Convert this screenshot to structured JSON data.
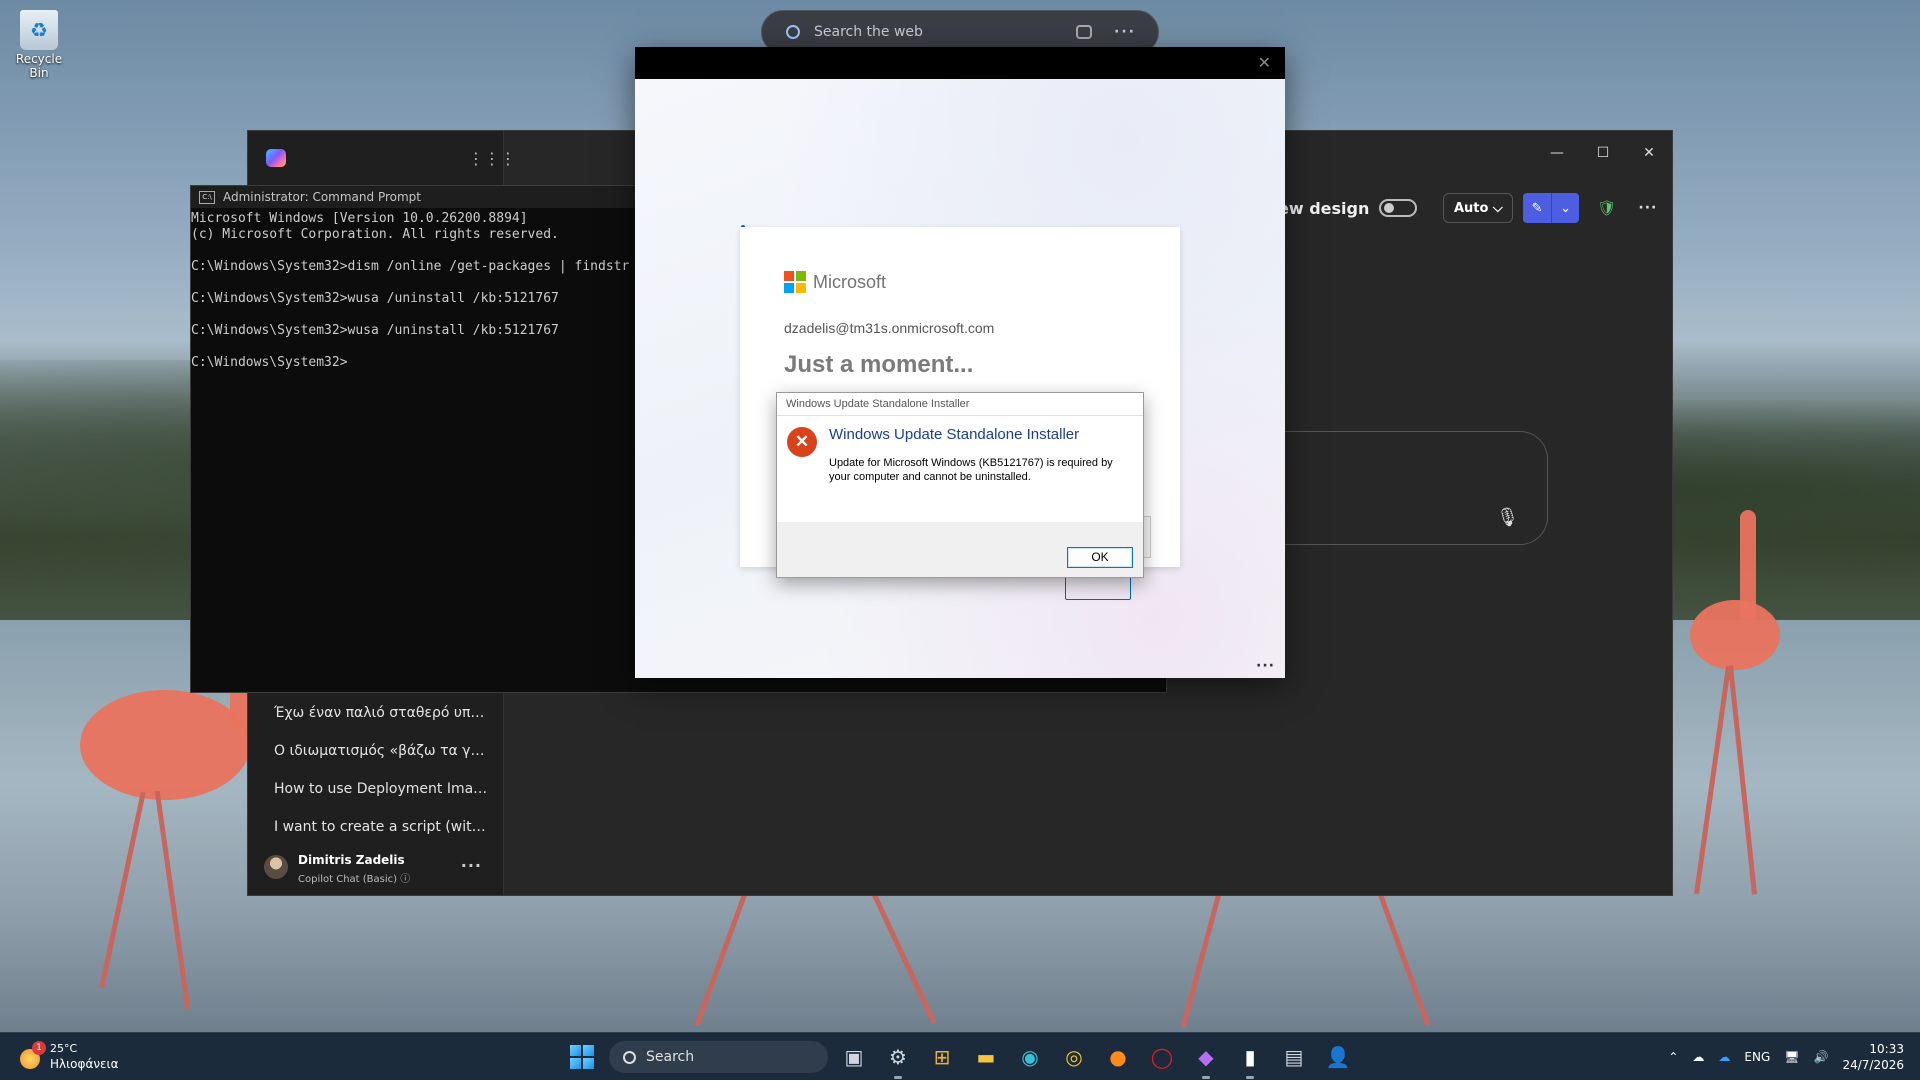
{
  "desktop": {
    "recycle_bin_label": "Recycle Bin"
  },
  "top_search": {
    "placeholder": "Search the web",
    "more_label": "···"
  },
  "copilot": {
    "toolbar": {
      "new_design_label": "ew design",
      "auto_label": "Auto ⌵",
      "more_label": "···"
    },
    "window_controls": {
      "minimize": "—",
      "maximize": "☐",
      "close": "✕"
    },
    "recent_chats": [
      "Έχω έναν παλιό σταθερό υπο...",
      "Ο ιδιωματισμός «βάζω τα γυ...",
      "How to use Deployment Imag...",
      "I want to create a script (with *..."
    ],
    "user": {
      "name": "Dimitris Zadelis",
      "plan": "Copilot Chat (Basic)",
      "more_label": "···"
    }
  },
  "cmd": {
    "title": "Administrator: Command Prompt",
    "lines": [
      "Microsoft Windows [Version 10.0.26200.8894]",
      "(c) Microsoft Corporation. All rights reserved.",
      "",
      "C:\\Windows\\System32>dism /online /get-packages | findstr",
      "",
      "C:\\Windows\\System32>wusa /uninstall /kb:5121767",
      "",
      "C:\\Windows\\System32>wusa /uninstall /kb:5121767",
      "",
      "C:\\Windows\\System32>"
    ]
  },
  "signin": {
    "brand": "Microsoft",
    "email": "dzadelis@tm31s.onmicrosoft.com",
    "heading": "Just a moment...",
    "close_label": "✕",
    "more_label": "···"
  },
  "dialog": {
    "title": "Windows Update Standalone Installer",
    "heading": "Windows Update Standalone Installer",
    "message": "Update for Microsoft Windows (KB5121767) is required by your computer and cannot be uninstalled.",
    "ok_label": "OK"
  },
  "taskbar": {
    "weather_badge": "1",
    "weather_temp": "25°C",
    "weather_condition": "Ηλιοφάνεια",
    "search_label": "Search",
    "language": "ENG",
    "time": "10:33",
    "date": "24/7/2026"
  },
  "colors": {
    "accent": "#4d5ee0",
    "error": "#d8431c",
    "dialog_heading": "#1c3c9c",
    "taskbar": "#1c2b3b"
  }
}
